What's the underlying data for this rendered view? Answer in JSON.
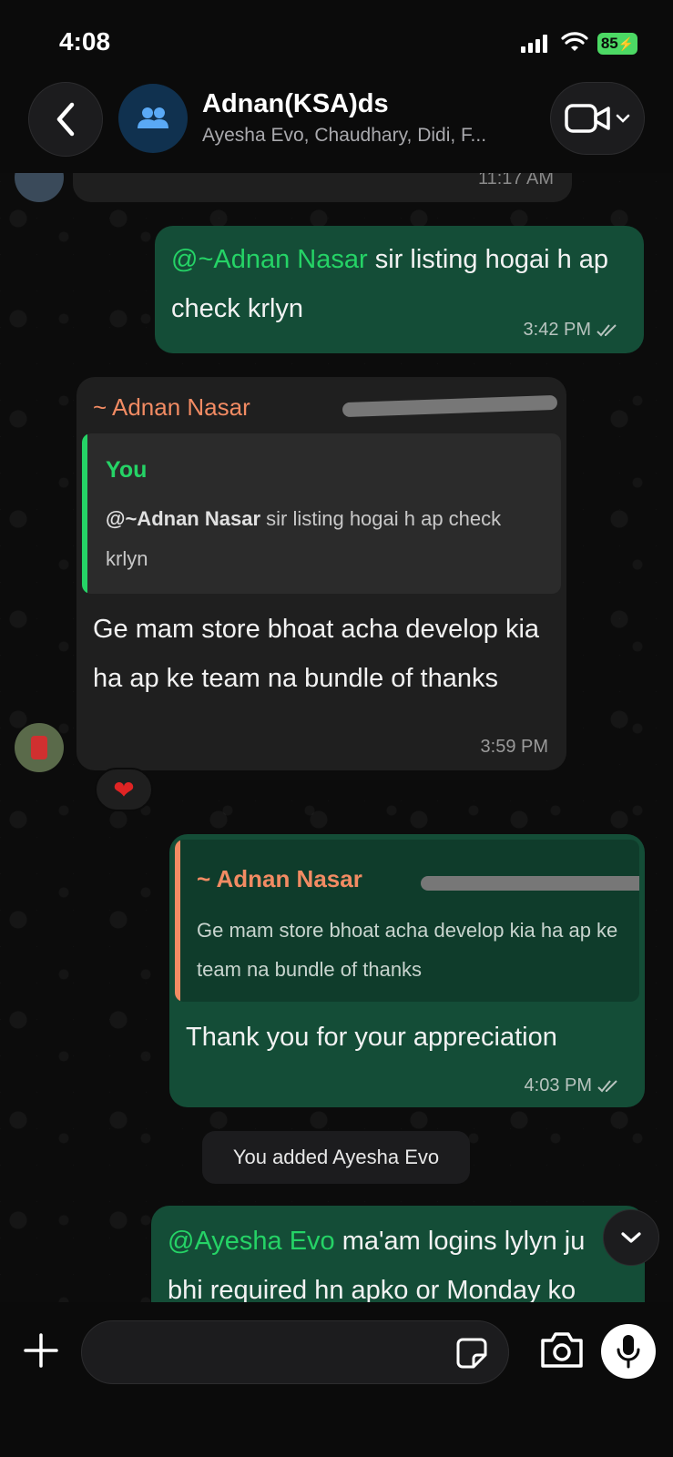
{
  "status_bar": {
    "time": "4:08",
    "battery": "85"
  },
  "header": {
    "title": "Adnan(KSA)ds",
    "subtitle": "Ayesha Evo, Chaudhary, Didi, F..."
  },
  "messages": {
    "top_partial": {
      "time": "11:17 AM"
    },
    "m1": {
      "mention": "@~Adnan Nasar",
      "text": " sir listing hogai h ap check krlyn",
      "time": "3:42 PM"
    },
    "m2": {
      "sender": "~ Adnan Nasar",
      "quote_author": "You",
      "quote_mention": "@~Adnan Nasar",
      "quote_text": " sir listing hogai h ap check krlyn",
      "text": "Ge mam store bhoat acha develop kia ha ap ke team na bundle of thanks",
      "time": "3:59 PM",
      "reaction": "❤"
    },
    "m3": {
      "quote_author": "~ Adnan Nasar",
      "quote_text": "Ge mam store bhoat acha develop kia ha ap ke team na bundle of thanks",
      "text": "Thank you for your appreciation",
      "time": "4:03 PM"
    },
    "system": "You added Ayesha Evo",
    "m4": {
      "mention": "@Ayesha Evo",
      "text": " ma'am logins lylyn ju bhi required hn apko or Monday ko"
    }
  },
  "composer": {
    "placeholder": ""
  },
  "colors": {
    "outgoing_bubble": "#144d37",
    "incoming_bubble": "#1f1f1f",
    "mention": "#25d366",
    "sender_name": "#f28b63"
  },
  "icons": [
    "back-chevron-icon",
    "group-icon",
    "video-call-icon",
    "chevron-down-icon",
    "double-check-icon",
    "plus-icon",
    "sticker-icon",
    "camera-icon",
    "mic-icon"
  ]
}
